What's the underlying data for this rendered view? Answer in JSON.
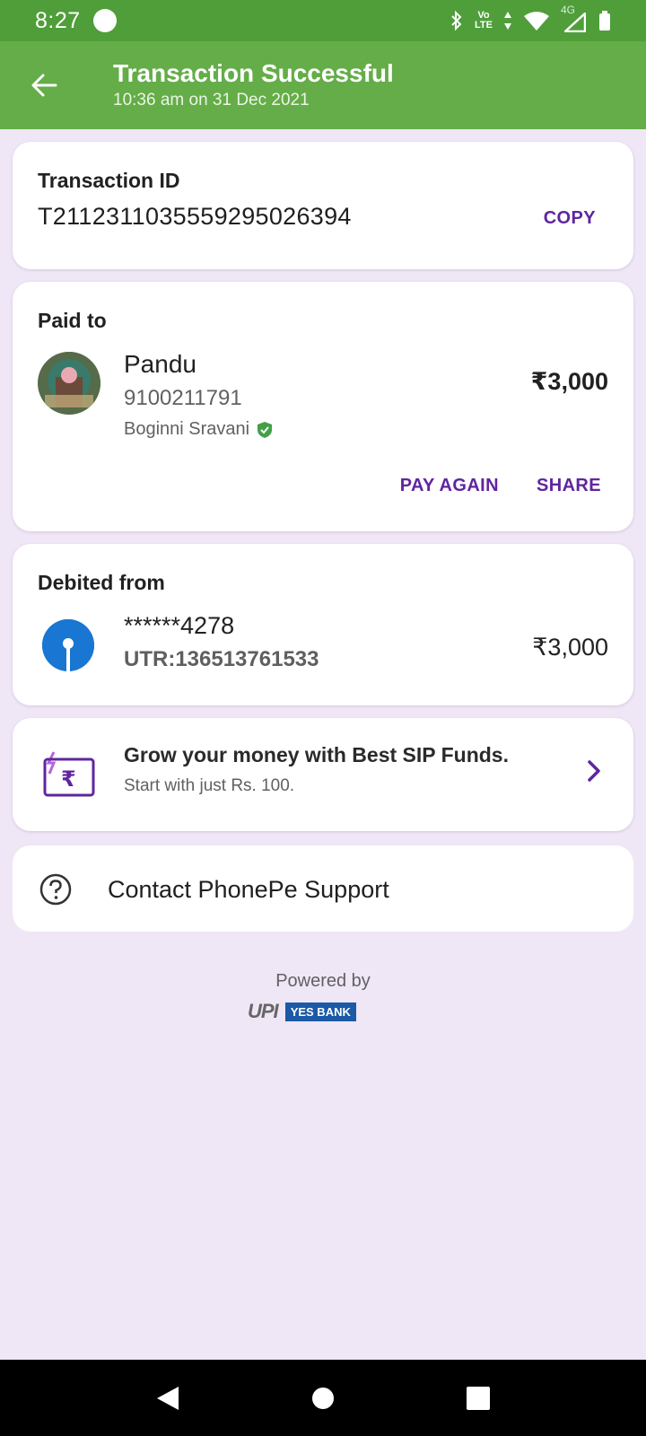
{
  "status_bar": {
    "time": "8:27",
    "network": "4G",
    "volte_top": "Vo",
    "volte_bottom": "LTE"
  },
  "header": {
    "title": "Transaction Successful",
    "subtitle": "10:36 am on 31 Dec 2021"
  },
  "transaction": {
    "label": "Transaction ID",
    "id": "T2112311035559295026394",
    "copy_label": "COPY"
  },
  "paid_to": {
    "label": "Paid to",
    "name": "Pandu",
    "phone": "9100211791",
    "bank_name": "Boginni Sravani",
    "amount": "₹3,000",
    "pay_again_label": "PAY AGAIN",
    "share_label": "SHARE"
  },
  "debited_from": {
    "label": "Debited from",
    "account": "******4278",
    "utr": "UTR:136513761533",
    "amount": "₹3,000"
  },
  "promo": {
    "title": "Grow your money with Best SIP Funds.",
    "subtitle": "Start with just Rs. 100."
  },
  "support": {
    "label": "Contact PhonePe Support"
  },
  "footer": {
    "powered_by": "Powered by",
    "upi_logo": "UPI",
    "bank_logo": "YES BANK"
  },
  "colors": {
    "accent": "#5f259f",
    "header_green": "#64ad48",
    "status_green": "#4f9e3a",
    "background": "#efe6f6",
    "verified": "#43a047"
  }
}
